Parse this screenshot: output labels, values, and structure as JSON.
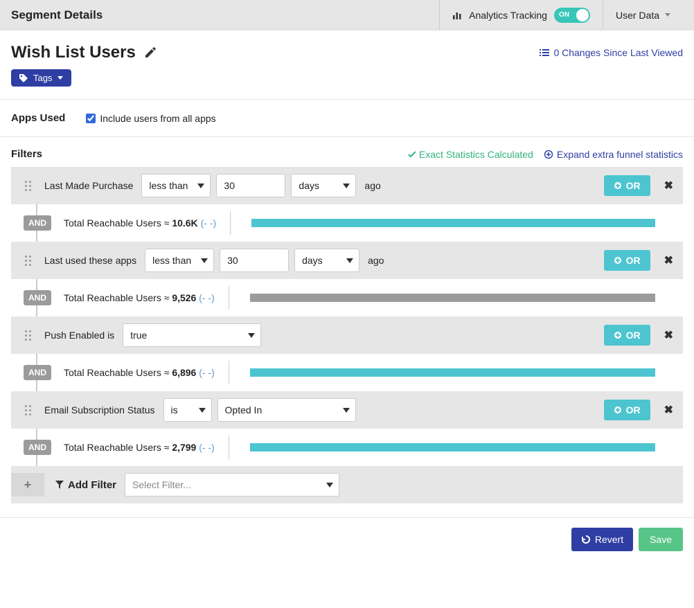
{
  "header": {
    "title": "Segment Details",
    "analytics_label": "Analytics Tracking",
    "toggle_state": "ON",
    "user_data_label": "User Data"
  },
  "segment": {
    "name": "Wish List Users",
    "changes_text": "0 Changes Since Last Viewed",
    "tags_label": "Tags"
  },
  "apps_used": {
    "label": "Apps Used",
    "checkbox_label": "Include users from all apps",
    "checked": true
  },
  "filters_section": {
    "title": "Filters",
    "exact_stats": "Exact Statistics Calculated",
    "expand_stats": "Expand extra funnel statistics",
    "or_label": "OR",
    "and_label": "AND",
    "ago_text": "ago",
    "reachable_prefix": "Total Reachable Users ≈ ",
    "dash": "(- -)",
    "add_filter_label": "Add Filter",
    "select_filter_placeholder": "Select Filter..."
  },
  "filters": [
    {
      "label": "Last Made Purchase",
      "operator": "less than",
      "value": "30",
      "unit": "days",
      "reachable": "10.6K",
      "bar_color": "#4cc5d0",
      "bar_width": "100%"
    },
    {
      "label": "Last used these apps",
      "operator": "less than",
      "value": "30",
      "unit": "days",
      "reachable": "9,526",
      "bar_color": "#9b9b9b",
      "bar_width": "100%"
    },
    {
      "label": "Push Enabled is",
      "bool_value": "true",
      "reachable": "6,896",
      "bar_color": "#4cc5d0",
      "bar_width": "100%"
    },
    {
      "label": "Email Subscription Status",
      "is_operator": "is",
      "status_value": "Opted In",
      "reachable": "2,799",
      "bar_color": "#4cc5d0",
      "bar_width": "100%"
    }
  ],
  "footer": {
    "revert": "Revert",
    "save": "Save"
  },
  "colors": {
    "teal": "#4cc5d0",
    "toggle": "#38c6b9",
    "indigo": "#2e3ea3",
    "green": "#57c587",
    "success": "#2fb47f",
    "gray": "#9b9b9b"
  }
}
